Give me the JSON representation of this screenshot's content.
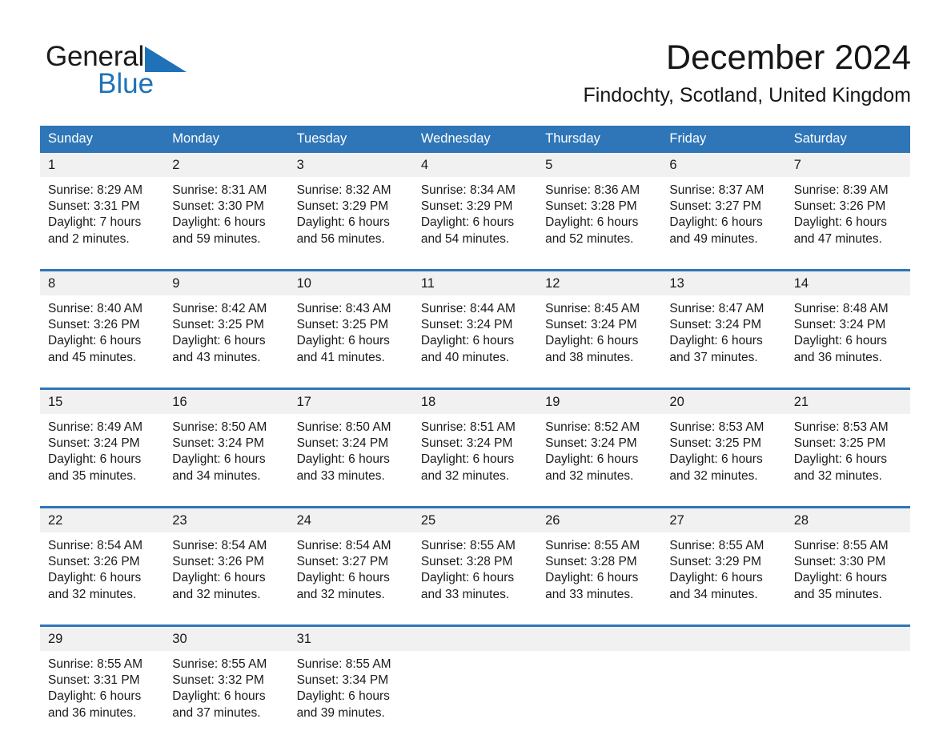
{
  "brand": {
    "name_part1": "General",
    "name_part2": "Blue",
    "flag_icon": "triangle-flag-icon",
    "accent_color": "#1f72b8"
  },
  "header": {
    "title": "December 2024",
    "location": "Findochty, Scotland, United Kingdom"
  },
  "theme": {
    "header_blue": "#2e76b8",
    "daynum_gray": "#f1f1f1",
    "text_color": "#1a1a1a",
    "cell_white": "#ffffff"
  },
  "calendar": {
    "weekday_headers": [
      "Sunday",
      "Monday",
      "Tuesday",
      "Wednesday",
      "Thursday",
      "Friday",
      "Saturday"
    ],
    "labels": {
      "sunrise": "Sunrise:",
      "sunset": "Sunset:",
      "daylight": "Daylight:"
    },
    "weeks": [
      {
        "days": [
          {
            "num": "1",
            "sunrise": "Sunrise: 8:29 AM",
            "sunset": "Sunset: 3:31 PM",
            "daylight_1": "Daylight: 7 hours",
            "daylight_2": "and 2 minutes."
          },
          {
            "num": "2",
            "sunrise": "Sunrise: 8:31 AM",
            "sunset": "Sunset: 3:30 PM",
            "daylight_1": "Daylight: 6 hours",
            "daylight_2": "and 59 minutes."
          },
          {
            "num": "3",
            "sunrise": "Sunrise: 8:32 AM",
            "sunset": "Sunset: 3:29 PM",
            "daylight_1": "Daylight: 6 hours",
            "daylight_2": "and 56 minutes."
          },
          {
            "num": "4",
            "sunrise": "Sunrise: 8:34 AM",
            "sunset": "Sunset: 3:29 PM",
            "daylight_1": "Daylight: 6 hours",
            "daylight_2": "and 54 minutes."
          },
          {
            "num": "5",
            "sunrise": "Sunrise: 8:36 AM",
            "sunset": "Sunset: 3:28 PM",
            "daylight_1": "Daylight: 6 hours",
            "daylight_2": "and 52 minutes."
          },
          {
            "num": "6",
            "sunrise": "Sunrise: 8:37 AM",
            "sunset": "Sunset: 3:27 PM",
            "daylight_1": "Daylight: 6 hours",
            "daylight_2": "and 49 minutes."
          },
          {
            "num": "7",
            "sunrise": "Sunrise: 8:39 AM",
            "sunset": "Sunset: 3:26 PM",
            "daylight_1": "Daylight: 6 hours",
            "daylight_2": "and 47 minutes."
          }
        ]
      },
      {
        "days": [
          {
            "num": "8",
            "sunrise": "Sunrise: 8:40 AM",
            "sunset": "Sunset: 3:26 PM",
            "daylight_1": "Daylight: 6 hours",
            "daylight_2": "and 45 minutes."
          },
          {
            "num": "9",
            "sunrise": "Sunrise: 8:42 AM",
            "sunset": "Sunset: 3:25 PM",
            "daylight_1": "Daylight: 6 hours",
            "daylight_2": "and 43 minutes."
          },
          {
            "num": "10",
            "sunrise": "Sunrise: 8:43 AM",
            "sunset": "Sunset: 3:25 PM",
            "daylight_1": "Daylight: 6 hours",
            "daylight_2": "and 41 minutes."
          },
          {
            "num": "11",
            "sunrise": "Sunrise: 8:44 AM",
            "sunset": "Sunset: 3:24 PM",
            "daylight_1": "Daylight: 6 hours",
            "daylight_2": "and 40 minutes."
          },
          {
            "num": "12",
            "sunrise": "Sunrise: 8:45 AM",
            "sunset": "Sunset: 3:24 PM",
            "daylight_1": "Daylight: 6 hours",
            "daylight_2": "and 38 minutes."
          },
          {
            "num": "13",
            "sunrise": "Sunrise: 8:47 AM",
            "sunset": "Sunset: 3:24 PM",
            "daylight_1": "Daylight: 6 hours",
            "daylight_2": "and 37 minutes."
          },
          {
            "num": "14",
            "sunrise": "Sunrise: 8:48 AM",
            "sunset": "Sunset: 3:24 PM",
            "daylight_1": "Daylight: 6 hours",
            "daylight_2": "and 36 minutes."
          }
        ]
      },
      {
        "days": [
          {
            "num": "15",
            "sunrise": "Sunrise: 8:49 AM",
            "sunset": "Sunset: 3:24 PM",
            "daylight_1": "Daylight: 6 hours",
            "daylight_2": "and 35 minutes."
          },
          {
            "num": "16",
            "sunrise": "Sunrise: 8:50 AM",
            "sunset": "Sunset: 3:24 PM",
            "daylight_1": "Daylight: 6 hours",
            "daylight_2": "and 34 minutes."
          },
          {
            "num": "17",
            "sunrise": "Sunrise: 8:50 AM",
            "sunset": "Sunset: 3:24 PM",
            "daylight_1": "Daylight: 6 hours",
            "daylight_2": "and 33 minutes."
          },
          {
            "num": "18",
            "sunrise": "Sunrise: 8:51 AM",
            "sunset": "Sunset: 3:24 PM",
            "daylight_1": "Daylight: 6 hours",
            "daylight_2": "and 32 minutes."
          },
          {
            "num": "19",
            "sunrise": "Sunrise: 8:52 AM",
            "sunset": "Sunset: 3:24 PM",
            "daylight_1": "Daylight: 6 hours",
            "daylight_2": "and 32 minutes."
          },
          {
            "num": "20",
            "sunrise": "Sunrise: 8:53 AM",
            "sunset": "Sunset: 3:25 PM",
            "daylight_1": "Daylight: 6 hours",
            "daylight_2": "and 32 minutes."
          },
          {
            "num": "21",
            "sunrise": "Sunrise: 8:53 AM",
            "sunset": "Sunset: 3:25 PM",
            "daylight_1": "Daylight: 6 hours",
            "daylight_2": "and 32 minutes."
          }
        ]
      },
      {
        "days": [
          {
            "num": "22",
            "sunrise": "Sunrise: 8:54 AM",
            "sunset": "Sunset: 3:26 PM",
            "daylight_1": "Daylight: 6 hours",
            "daylight_2": "and 32 minutes."
          },
          {
            "num": "23",
            "sunrise": "Sunrise: 8:54 AM",
            "sunset": "Sunset: 3:26 PM",
            "daylight_1": "Daylight: 6 hours",
            "daylight_2": "and 32 minutes."
          },
          {
            "num": "24",
            "sunrise": "Sunrise: 8:54 AM",
            "sunset": "Sunset: 3:27 PM",
            "daylight_1": "Daylight: 6 hours",
            "daylight_2": "and 32 minutes."
          },
          {
            "num": "25",
            "sunrise": "Sunrise: 8:55 AM",
            "sunset": "Sunset: 3:28 PM",
            "daylight_1": "Daylight: 6 hours",
            "daylight_2": "and 33 minutes."
          },
          {
            "num": "26",
            "sunrise": "Sunrise: 8:55 AM",
            "sunset": "Sunset: 3:28 PM",
            "daylight_1": "Daylight: 6 hours",
            "daylight_2": "and 33 minutes."
          },
          {
            "num": "27",
            "sunrise": "Sunrise: 8:55 AM",
            "sunset": "Sunset: 3:29 PM",
            "daylight_1": "Daylight: 6 hours",
            "daylight_2": "and 34 minutes."
          },
          {
            "num": "28",
            "sunrise": "Sunrise: 8:55 AM",
            "sunset": "Sunset: 3:30 PM",
            "daylight_1": "Daylight: 6 hours",
            "daylight_2": "and 35 minutes."
          }
        ]
      },
      {
        "days": [
          {
            "num": "29",
            "sunrise": "Sunrise: 8:55 AM",
            "sunset": "Sunset: 3:31 PM",
            "daylight_1": "Daylight: 6 hours",
            "daylight_2": "and 36 minutes."
          },
          {
            "num": "30",
            "sunrise": "Sunrise: 8:55 AM",
            "sunset": "Sunset: 3:32 PM",
            "daylight_1": "Daylight: 6 hours",
            "daylight_2": "and 37 minutes."
          },
          {
            "num": "31",
            "sunrise": "Sunrise: 8:55 AM",
            "sunset": "Sunset: 3:34 PM",
            "daylight_1": "Daylight: 6 hours",
            "daylight_2": "and 39 minutes."
          },
          {
            "num": "",
            "sunrise": "",
            "sunset": "",
            "daylight_1": "",
            "daylight_2": ""
          },
          {
            "num": "",
            "sunrise": "",
            "sunset": "",
            "daylight_1": "",
            "daylight_2": ""
          },
          {
            "num": "",
            "sunrise": "",
            "sunset": "",
            "daylight_1": "",
            "daylight_2": ""
          },
          {
            "num": "",
            "sunrise": "",
            "sunset": "",
            "daylight_1": "",
            "daylight_2": ""
          }
        ]
      }
    ]
  }
}
